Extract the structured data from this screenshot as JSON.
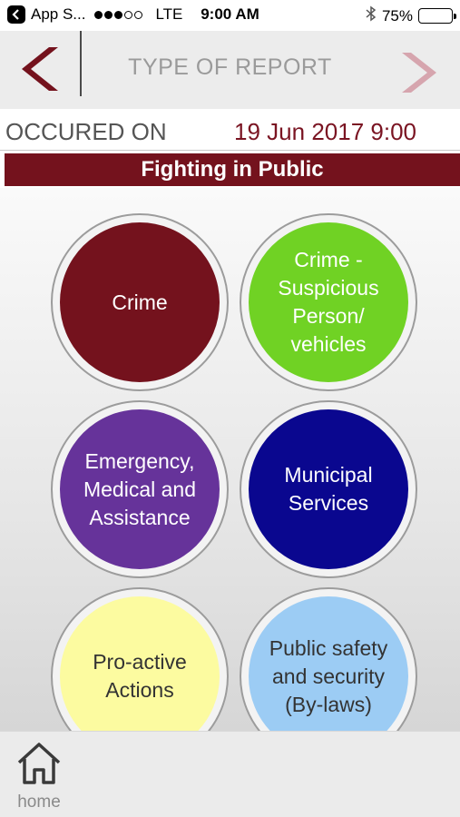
{
  "status_bar": {
    "back_app": "App S...",
    "carrier": "LTE",
    "time": "9:00 AM",
    "battery": "75%",
    "battery_level": 0.75
  },
  "header": {
    "title": "TYPE OF REPORT"
  },
  "occurred": {
    "label": "OCCURED ON",
    "value": "19 Jun 2017 9:00"
  },
  "banner": {
    "text": "Fighting in Public"
  },
  "categories": [
    {
      "label": "Crime",
      "color": "#74121d",
      "text_color": "#ffffff"
    },
    {
      "label": "Crime - Suspicious Person/ vehicles",
      "color": "#70d224",
      "text_color": "#ffffff"
    },
    {
      "label": "Emergency, Medical and Assistance",
      "color": "#66339a",
      "text_color": "#ffffff"
    },
    {
      "label": "Municipal Services",
      "color": "#0a078f",
      "text_color": "#ffffff"
    },
    {
      "label": "Pro-active Actions",
      "color": "#fcfba0",
      "text_color": "#333333"
    },
    {
      "label": "Public safety and security (By-laws)",
      "color": "#9cccf4",
      "text_color": "#333333"
    }
  ],
  "tab_bar": {
    "home_label": "home"
  },
  "colors": {
    "accent": "#74121d",
    "accent_light": "#d6a5ae"
  }
}
